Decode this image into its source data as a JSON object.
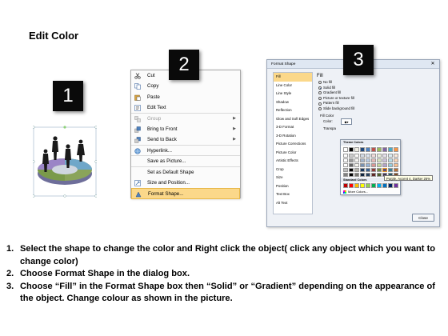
{
  "title": "Edit Color",
  "steps": {
    "one": "1",
    "two": "2",
    "three": "3"
  },
  "context_menu": {
    "items": [
      {
        "label": "Cut",
        "icon": "scissors-icon",
        "state": "normal"
      },
      {
        "label": "Copy",
        "icon": "copy-icon",
        "state": "normal"
      },
      {
        "label": "Paste",
        "icon": "paste-icon",
        "state": "normal"
      },
      {
        "label": "Edit Text",
        "icon": "edit-text-icon",
        "state": "normal"
      },
      {
        "label": "Group",
        "icon": "group-icon",
        "state": "disabled"
      },
      {
        "label": "Bring to Front",
        "icon": "bring-to-front-icon",
        "state": "normal"
      },
      {
        "label": "Send to Back",
        "icon": "send-to-back-icon",
        "state": "normal"
      },
      {
        "label": "Hyperlink...",
        "icon": "hyperlink-icon",
        "state": "normal"
      },
      {
        "label": "Save as Picture...",
        "icon": "",
        "state": "normal"
      },
      {
        "label": "Set as Default Shape",
        "icon": "",
        "state": "normal"
      },
      {
        "label": "Size and Position...",
        "icon": "size-position-icon",
        "state": "normal"
      },
      {
        "label": "Format Shape...",
        "icon": "format-shape-icon",
        "state": "active"
      }
    ]
  },
  "dialog": {
    "title": "Format Shape",
    "categories": [
      "Fill",
      "Line Color",
      "Line Style",
      "Shadow",
      "Reflection",
      "Glow and Soft Edges",
      "3-D Format",
      "3-D Rotation",
      "Picture Corrections",
      "Picture Color",
      "Artistic Effects",
      "Crop",
      "Size",
      "Position",
      "Text Box",
      "Alt Text"
    ],
    "fill_heading": "Fill",
    "fill_options": [
      "No fill",
      "Solid fill",
      "Gradient fill",
      "Picture or texture fill",
      "Pattern fill",
      "Slide background fill"
    ],
    "selected_fill": "Solid fill",
    "fill_color_label": "Fill Color",
    "color_label": "Color:",
    "transparency_label": "Transpa",
    "close_button": "Close"
  },
  "palette": {
    "theme_heading": "Theme Colors",
    "standard_heading": "Standard Colors",
    "more_colors": "More Colors...",
    "tooltip": "Purple, Accent 4, Darker 25%",
    "theme_top": [
      "#ffffff",
      "#000000",
      "#eeece1",
      "#1f497d",
      "#4f81bd",
      "#c0504d",
      "#9bbb59",
      "#8064a2",
      "#4bacc6",
      "#f79646"
    ],
    "standard": [
      "#c00000",
      "#ff0000",
      "#ffc000",
      "#ffff00",
      "#92d050",
      "#00b050",
      "#00b0f0",
      "#0070c0",
      "#002060",
      "#7030a0"
    ]
  },
  "instructions": [
    {
      "num": "1.",
      "text": "Select the shape to change the color and Right click the object( click any object which you want to change color)"
    },
    {
      "num": "2.",
      "text": "Choose Format Shape in the dialog box."
    },
    {
      "num": "3.",
      "text": "Choose “Fill” in the Format Shape box then “Solid” or “Gradient” depending on the appearance of the object. Change colour as shown in the picture."
    }
  ]
}
